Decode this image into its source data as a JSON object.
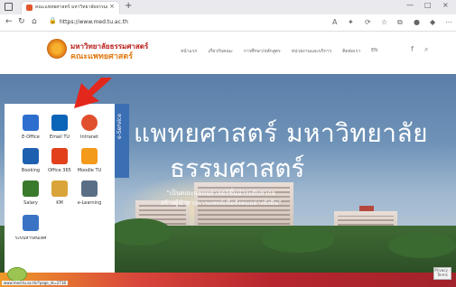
{
  "browser": {
    "tab_title": "คณะแพทยศาสตร์ มหาวิทยาลัยธรรมศาสตร์",
    "tab_close": "×",
    "new_tab": "+",
    "url": "https://www.med.tu.ac.th",
    "window_controls": [
      "—",
      "□",
      "×"
    ]
  },
  "site": {
    "logo_line1": "มหาวิทยาลัยธรรมศาสตร์",
    "logo_line2": "คณะแพทยศาสตร์",
    "nav": [
      "หน้าแรก",
      "เกี่ยวกับคณะ",
      "การศึกษา/หลักสูตร",
      "หน่วยงานและบริการ",
      "ติดต่อเรา",
      "EN"
    ]
  },
  "hero": {
    "title_line1": "แพทยศาสตร์ มหาวิทยาลัย",
    "title_line2": "ธรรมศาสตร์",
    "quote_line1": "\"เป็นคณะแพทยศาสตร์ชั้นนำระดับสากล",
    "quote_line2": "สร้างผู้นำทางการแพทย์เพื่อสังคมอย่างยั่งยืน\""
  },
  "eservice": {
    "tab_label": "e-Service",
    "items": [
      {
        "label": "E-Office",
        "icon": "e-office-icon",
        "color": "#2c6fce"
      },
      {
        "label": "Email TU",
        "icon": "outlook-mail-icon",
        "color": "#0a64b8"
      },
      {
        "label": "Intranet",
        "icon": "intranet-icon",
        "color": "#e0502c"
      },
      {
        "label": "Booking",
        "icon": "booking-icon",
        "color": "#1e5fb0"
      },
      {
        "label": "Office 365",
        "icon": "office365-icon",
        "color": "#e2401b"
      },
      {
        "label": "Moodle TU",
        "icon": "moodle-icon",
        "color": "#f39a1b"
      },
      {
        "label": "Salary",
        "icon": "salary-icon",
        "color": "#3a7a2d"
      },
      {
        "label": "KM",
        "icon": "km-icon",
        "color": "#d9a43a"
      },
      {
        "label": "e-Learning",
        "icon": "elearning-icon",
        "color": "#5a6f86"
      },
      {
        "label": "ระบบสารสนเทศ",
        "icon": "info-system-icon",
        "color": "#3b73c4"
      }
    ]
  },
  "status_bar_url": "www.med.tu.ac.th/?page_id=2718",
  "accessibility_badge": "Privacy - Terms"
}
